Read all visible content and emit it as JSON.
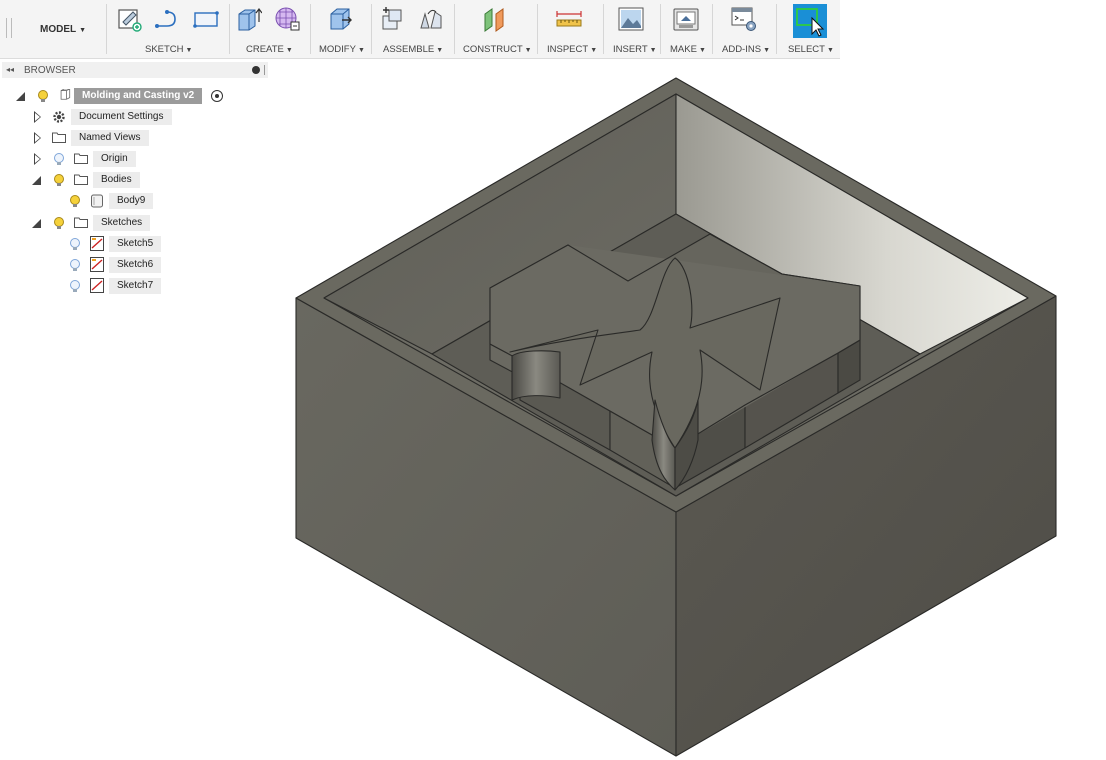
{
  "toolbar": {
    "workspace": "MODEL",
    "groups": [
      {
        "id": "sketch",
        "label": "SKETCH"
      },
      {
        "id": "create",
        "label": "CREATE"
      },
      {
        "id": "modify",
        "label": "MODIFY"
      },
      {
        "id": "assemble",
        "label": "ASSEMBLE"
      },
      {
        "id": "construct",
        "label": "CONSTRUCT"
      },
      {
        "id": "inspect",
        "label": "INSPECT"
      },
      {
        "id": "insert",
        "label": "INSERT"
      },
      {
        "id": "make",
        "label": "MAKE"
      },
      {
        "id": "addins",
        "label": "ADD-INS"
      },
      {
        "id": "select",
        "label": "SELECT"
      }
    ],
    "select_accent": "#1a8fd6"
  },
  "browser": {
    "title": "BROWSER",
    "root": "Molding and Casting v2",
    "items": [
      {
        "label": "Document Settings",
        "icon": "gear-icon"
      },
      {
        "label": "Named Views",
        "icon": "folder-icon"
      },
      {
        "label": "Origin",
        "icon": "folder-icon"
      },
      {
        "label": "Bodies",
        "icon": "folder-icon"
      },
      {
        "label": "Body9",
        "icon": "body-icon"
      },
      {
        "label": "Sketches",
        "icon": "folder-icon"
      },
      {
        "label": "Sketch5",
        "icon": "sketch-icon"
      },
      {
        "label": "Sketch6",
        "icon": "sketch-icon"
      },
      {
        "label": "Sketch7",
        "icon": "sketch-icon"
      }
    ]
  },
  "colors": {
    "model_top": "#6b6a61",
    "model_left": "#65645c",
    "model_right": "#58564f",
    "bulb_on": "#f5d13a",
    "bulb_off": "#7fa6d9"
  }
}
